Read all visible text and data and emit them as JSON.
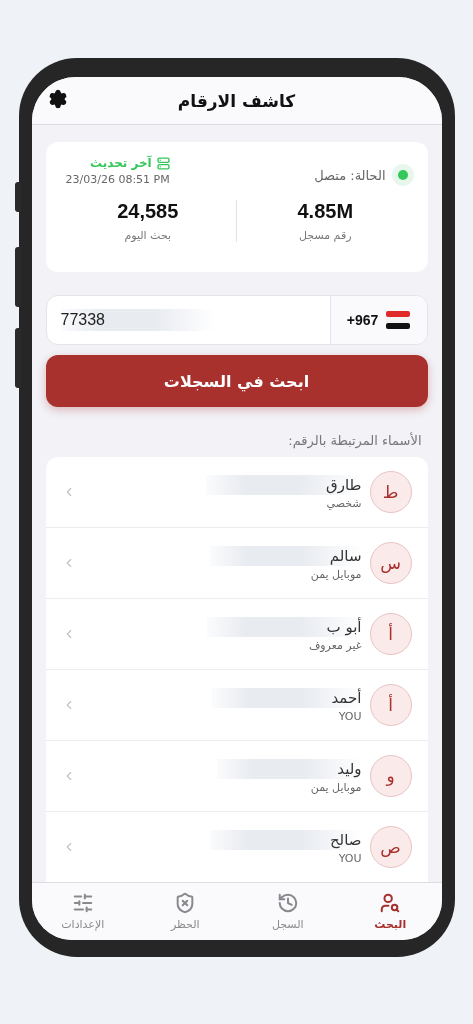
{
  "header": {
    "title": "كاشف الارقام"
  },
  "status": {
    "label": "الحالة: متصل",
    "connected": true
  },
  "update": {
    "label": "آخر تحديث",
    "time": "23/03/26 08:51 PM"
  },
  "stats": [
    {
      "value": "4.85M",
      "label": "رقم مسجل"
    },
    {
      "value": "24,585",
      "label": "بحث اليوم"
    }
  ],
  "phone": {
    "country_code": "+967",
    "value": "77338"
  },
  "search_button": "ابحث في السجلات",
  "section_title": "الأسماء المرتبطة بالرقم:",
  "names": [
    {
      "initial": "ط",
      "name": "طارق",
      "tag": "شخصي"
    },
    {
      "initial": "س",
      "name": "سالم",
      "tag": "موبايل يمن"
    },
    {
      "initial": "أ",
      "name": "أبو ب",
      "tag": "غير معروف"
    },
    {
      "initial": "أ",
      "name": "أحمد",
      "tag": "YOU"
    },
    {
      "initial": "و",
      "name": "وليد",
      "tag": "موبايل يمن"
    },
    {
      "initial": "ص",
      "name": "صالح",
      "tag": "YOU"
    }
  ],
  "tabs": [
    {
      "label": "البحث",
      "selected": true
    },
    {
      "label": "السجل",
      "selected": false
    },
    {
      "label": "الحظر",
      "selected": false
    },
    {
      "label": "الإعدادات",
      "selected": false
    }
  ]
}
